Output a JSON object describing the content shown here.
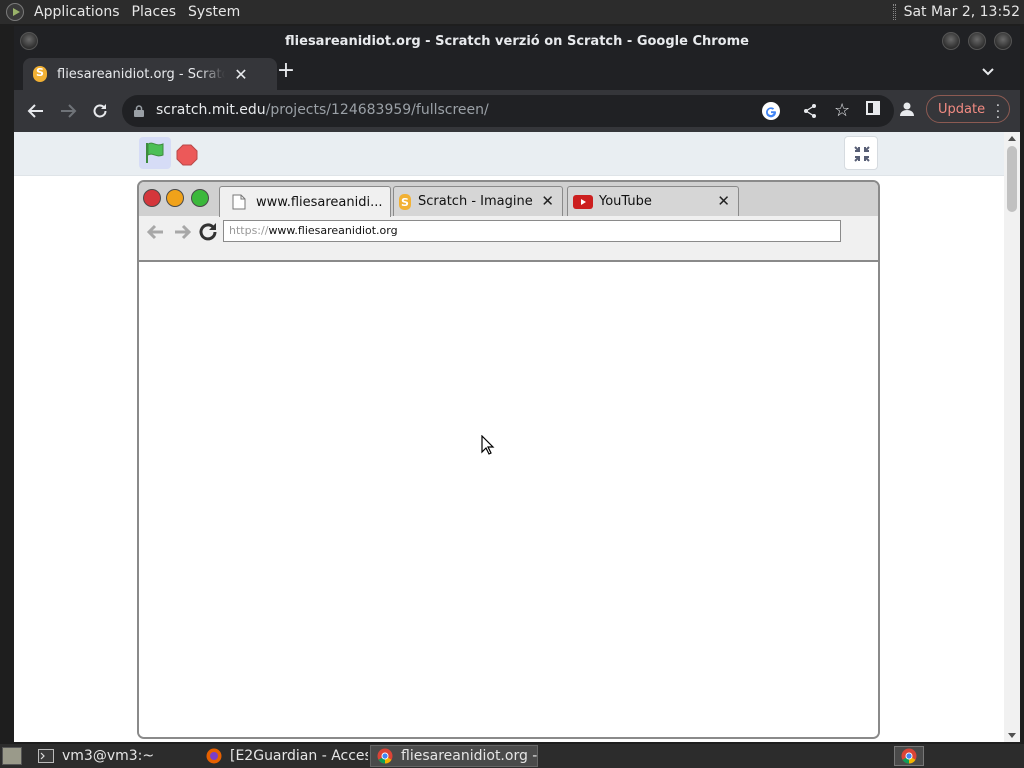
{
  "top_panel": {
    "menus": [
      "Applications",
      "Places",
      "System"
    ],
    "clock": "Sat Mar  2, 13:52"
  },
  "window": {
    "title": "fliesareanidiot.org - Scratch verzió on Scratch - Google Chrome"
  },
  "tab": {
    "title": "fliesareanidiot.org - Scratch verzió on Scratch",
    "close": "✕",
    "new_tab": "+"
  },
  "toolbar": {
    "url_host": "scratch.mit.edu",
    "url_path": "/projects/124683959/fullscreen/",
    "update_label": "Update"
  },
  "scratch_stage": {
    "tabs": [
      {
        "label": "www.fliesareanidi...",
        "icon": "page-icon"
      },
      {
        "label": "Scratch - Imagine",
        "icon": "scratch-icon"
      },
      {
        "label": "YouTube",
        "icon": "youtube-icon"
      }
    ],
    "tab_close": "✕",
    "url_protocol": "https://",
    "url_host": "www.fliesareanidiot.org"
  },
  "taskbar": {
    "tasks": [
      {
        "label": "vm3@vm3:~",
        "icon": "terminal-icon"
      },
      {
        "label": "[E2Guardian - Acces...",
        "icon": "firefox-icon"
      },
      {
        "label": "fliesareanidiot.org - ...",
        "icon": "chrome-icon"
      }
    ]
  },
  "colors": {
    "panel_bg": "#2c2c2c",
    "chrome_frame": "#202124",
    "chrome_toolbar": "#35363a",
    "update_accent": "#f28b82",
    "scratch_bar_bg": "#e9eef2"
  }
}
